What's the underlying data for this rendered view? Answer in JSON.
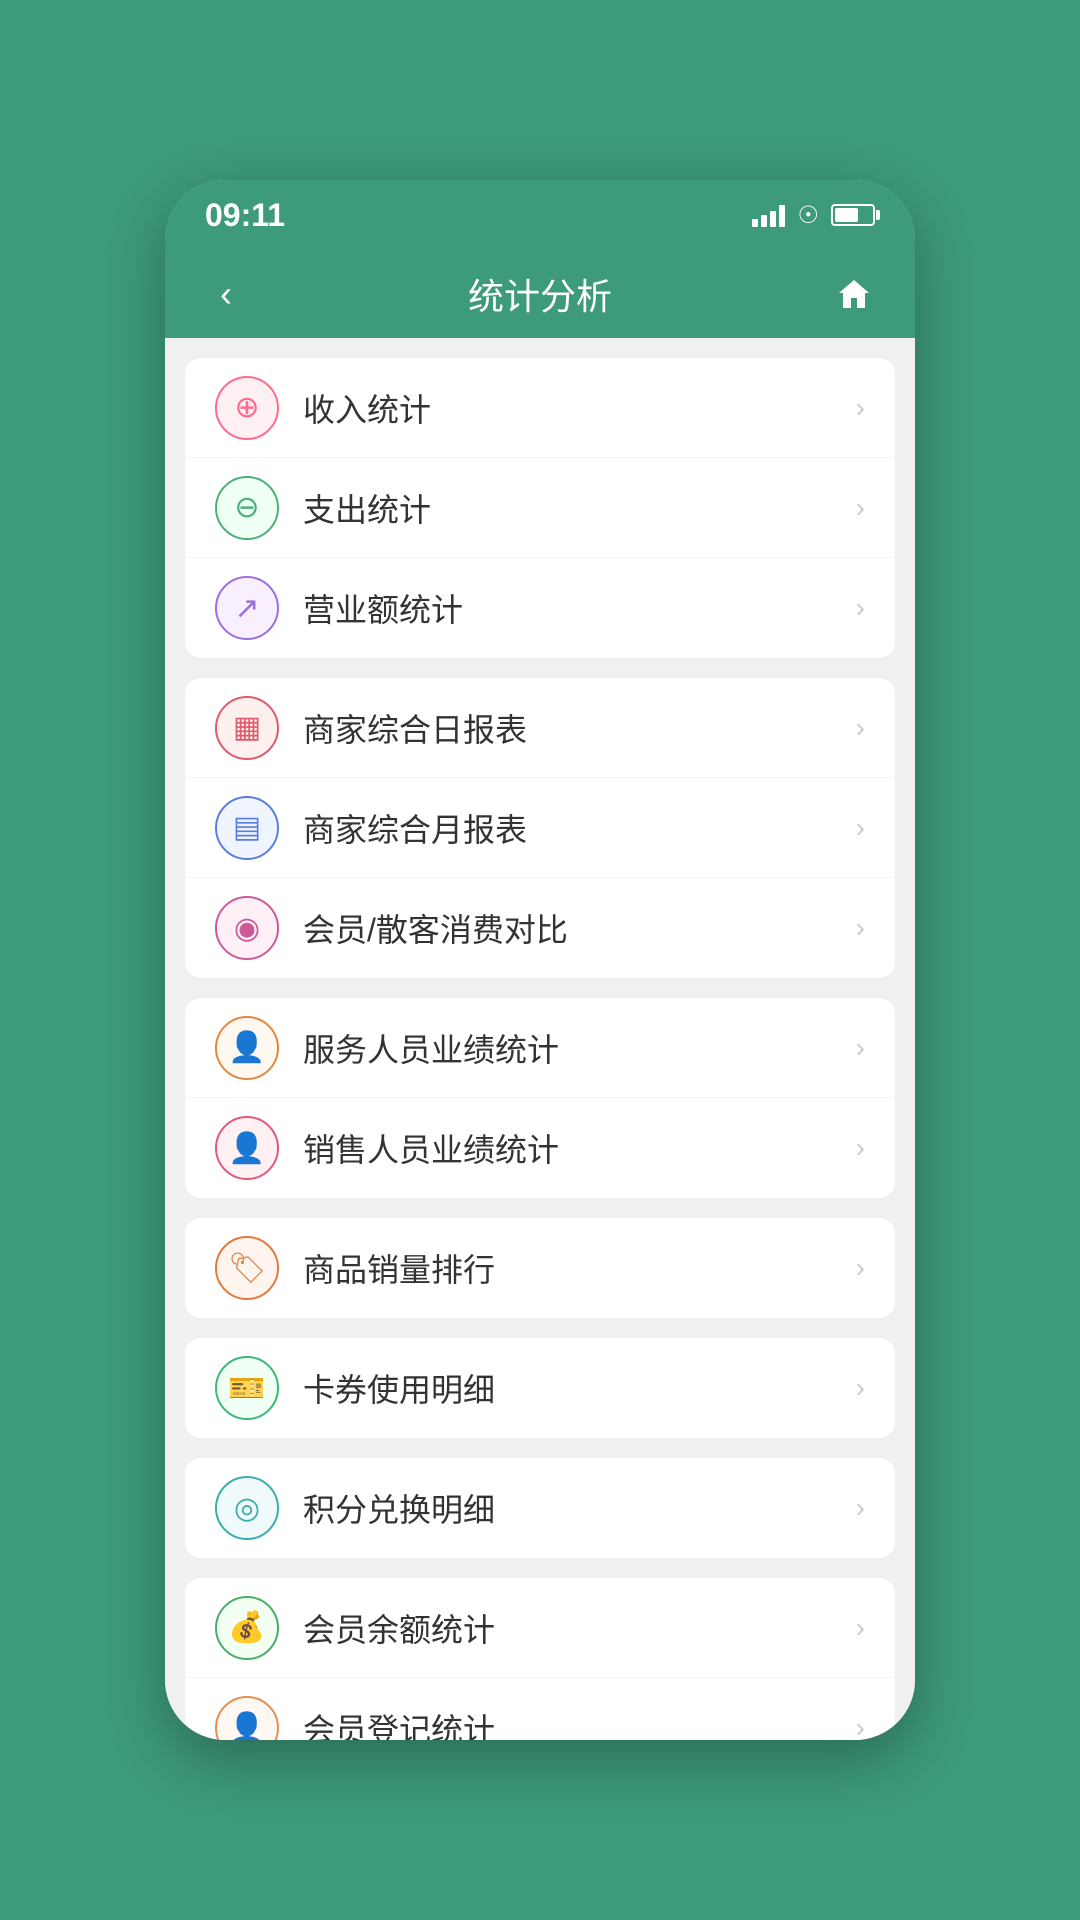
{
  "statusBar": {
    "time": "09:11"
  },
  "navBar": {
    "title": "统计分析",
    "backLabel": "‹",
    "homeLabel": "⌂"
  },
  "menuGroups": [
    {
      "id": "group1",
      "items": [
        {
          "id": "income-stat",
          "label": "收入统计",
          "iconClass": "icon-pink",
          "iconSymbol": "⊕"
        },
        {
          "id": "expense-stat",
          "label": "支出统计",
          "iconClass": "icon-green",
          "iconSymbol": "⊖"
        },
        {
          "id": "sales-stat",
          "label": "营业额统计",
          "iconClass": "icon-purple",
          "iconSymbol": "↗"
        }
      ]
    },
    {
      "id": "group2",
      "items": [
        {
          "id": "daily-report",
          "label": "商家综合日报表",
          "iconClass": "icon-red-outline",
          "iconSymbol": "▦"
        },
        {
          "id": "monthly-report",
          "label": "商家综合月报表",
          "iconClass": "icon-blue",
          "iconSymbol": "▤"
        },
        {
          "id": "member-compare",
          "label": "会员/散客消费对比",
          "iconClass": "icon-magenta",
          "iconSymbol": "◉"
        }
      ]
    },
    {
      "id": "group3",
      "items": [
        {
          "id": "service-perf",
          "label": "服务人员业绩统计",
          "iconClass": "icon-orange-outline",
          "iconSymbol": "👤"
        },
        {
          "id": "sales-perf",
          "label": "销售人员业绩统计",
          "iconClass": "icon-pink-outline",
          "iconSymbol": "👤"
        }
      ]
    },
    {
      "id": "group4",
      "items": [
        {
          "id": "product-rank",
          "label": "商品销量排行",
          "iconClass": "icon-orange",
          "iconSymbol": "🏷"
        }
      ]
    },
    {
      "id": "group5",
      "items": [
        {
          "id": "coupon-detail",
          "label": "卡券使用明细",
          "iconClass": "icon-green2",
          "iconSymbol": "🎫"
        }
      ]
    },
    {
      "id": "group6",
      "items": [
        {
          "id": "points-exchange",
          "label": "积分兑换明细",
          "iconClass": "icon-teal",
          "iconSymbol": "◎"
        }
      ]
    },
    {
      "id": "group7",
      "items": [
        {
          "id": "member-balance",
          "label": "会员余额统计",
          "iconClass": "icon-green3",
          "iconSymbol": "💰"
        },
        {
          "id": "member-register",
          "label": "会员登记统计",
          "iconClass": "icon-orange2",
          "iconSymbol": "👤"
        }
      ]
    }
  ],
  "arrowSymbol": "›"
}
